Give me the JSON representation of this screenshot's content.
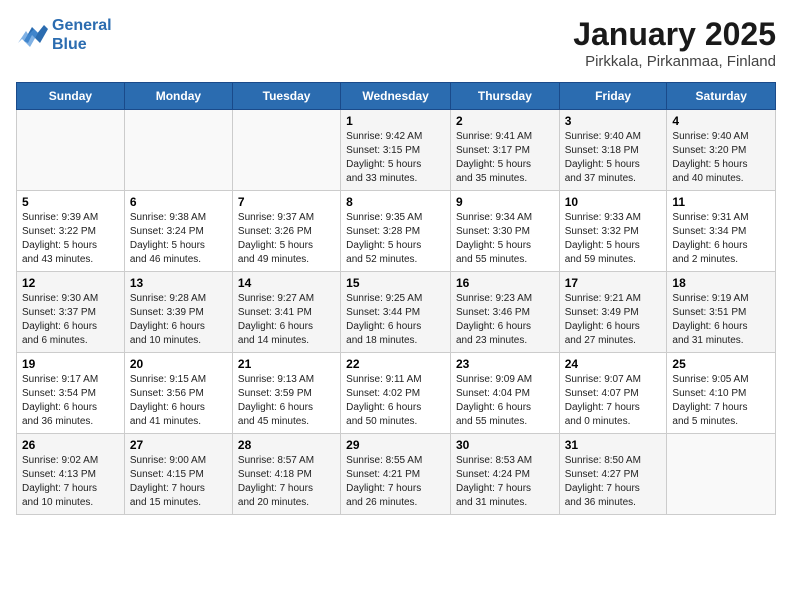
{
  "header": {
    "logo_line1": "General",
    "logo_line2": "Blue",
    "month": "January 2025",
    "location": "Pirkkala, Pirkanmaa, Finland"
  },
  "days_of_week": [
    "Sunday",
    "Monday",
    "Tuesday",
    "Wednesday",
    "Thursday",
    "Friday",
    "Saturday"
  ],
  "weeks": [
    [
      {
        "day": "",
        "info": ""
      },
      {
        "day": "",
        "info": ""
      },
      {
        "day": "",
        "info": ""
      },
      {
        "day": "1",
        "info": "Sunrise: 9:42 AM\nSunset: 3:15 PM\nDaylight: 5 hours\nand 33 minutes."
      },
      {
        "day": "2",
        "info": "Sunrise: 9:41 AM\nSunset: 3:17 PM\nDaylight: 5 hours\nand 35 minutes."
      },
      {
        "day": "3",
        "info": "Sunrise: 9:40 AM\nSunset: 3:18 PM\nDaylight: 5 hours\nand 37 minutes."
      },
      {
        "day": "4",
        "info": "Sunrise: 9:40 AM\nSunset: 3:20 PM\nDaylight: 5 hours\nand 40 minutes."
      }
    ],
    [
      {
        "day": "5",
        "info": "Sunrise: 9:39 AM\nSunset: 3:22 PM\nDaylight: 5 hours\nand 43 minutes."
      },
      {
        "day": "6",
        "info": "Sunrise: 9:38 AM\nSunset: 3:24 PM\nDaylight: 5 hours\nand 46 minutes."
      },
      {
        "day": "7",
        "info": "Sunrise: 9:37 AM\nSunset: 3:26 PM\nDaylight: 5 hours\nand 49 minutes."
      },
      {
        "day": "8",
        "info": "Sunrise: 9:35 AM\nSunset: 3:28 PM\nDaylight: 5 hours\nand 52 minutes."
      },
      {
        "day": "9",
        "info": "Sunrise: 9:34 AM\nSunset: 3:30 PM\nDaylight: 5 hours\nand 55 minutes."
      },
      {
        "day": "10",
        "info": "Sunrise: 9:33 AM\nSunset: 3:32 PM\nDaylight: 5 hours\nand 59 minutes."
      },
      {
        "day": "11",
        "info": "Sunrise: 9:31 AM\nSunset: 3:34 PM\nDaylight: 6 hours\nand 2 minutes."
      }
    ],
    [
      {
        "day": "12",
        "info": "Sunrise: 9:30 AM\nSunset: 3:37 PM\nDaylight: 6 hours\nand 6 minutes."
      },
      {
        "day": "13",
        "info": "Sunrise: 9:28 AM\nSunset: 3:39 PM\nDaylight: 6 hours\nand 10 minutes."
      },
      {
        "day": "14",
        "info": "Sunrise: 9:27 AM\nSunset: 3:41 PM\nDaylight: 6 hours\nand 14 minutes."
      },
      {
        "day": "15",
        "info": "Sunrise: 9:25 AM\nSunset: 3:44 PM\nDaylight: 6 hours\nand 18 minutes."
      },
      {
        "day": "16",
        "info": "Sunrise: 9:23 AM\nSunset: 3:46 PM\nDaylight: 6 hours\nand 23 minutes."
      },
      {
        "day": "17",
        "info": "Sunrise: 9:21 AM\nSunset: 3:49 PM\nDaylight: 6 hours\nand 27 minutes."
      },
      {
        "day": "18",
        "info": "Sunrise: 9:19 AM\nSunset: 3:51 PM\nDaylight: 6 hours\nand 31 minutes."
      }
    ],
    [
      {
        "day": "19",
        "info": "Sunrise: 9:17 AM\nSunset: 3:54 PM\nDaylight: 6 hours\nand 36 minutes."
      },
      {
        "day": "20",
        "info": "Sunrise: 9:15 AM\nSunset: 3:56 PM\nDaylight: 6 hours\nand 41 minutes."
      },
      {
        "day": "21",
        "info": "Sunrise: 9:13 AM\nSunset: 3:59 PM\nDaylight: 6 hours\nand 45 minutes."
      },
      {
        "day": "22",
        "info": "Sunrise: 9:11 AM\nSunset: 4:02 PM\nDaylight: 6 hours\nand 50 minutes."
      },
      {
        "day": "23",
        "info": "Sunrise: 9:09 AM\nSunset: 4:04 PM\nDaylight: 6 hours\nand 55 minutes."
      },
      {
        "day": "24",
        "info": "Sunrise: 9:07 AM\nSunset: 4:07 PM\nDaylight: 7 hours\nand 0 minutes."
      },
      {
        "day": "25",
        "info": "Sunrise: 9:05 AM\nSunset: 4:10 PM\nDaylight: 7 hours\nand 5 minutes."
      }
    ],
    [
      {
        "day": "26",
        "info": "Sunrise: 9:02 AM\nSunset: 4:13 PM\nDaylight: 7 hours\nand 10 minutes."
      },
      {
        "day": "27",
        "info": "Sunrise: 9:00 AM\nSunset: 4:15 PM\nDaylight: 7 hours\nand 15 minutes."
      },
      {
        "day": "28",
        "info": "Sunrise: 8:57 AM\nSunset: 4:18 PM\nDaylight: 7 hours\nand 20 minutes."
      },
      {
        "day": "29",
        "info": "Sunrise: 8:55 AM\nSunset: 4:21 PM\nDaylight: 7 hours\nand 26 minutes."
      },
      {
        "day": "30",
        "info": "Sunrise: 8:53 AM\nSunset: 4:24 PM\nDaylight: 7 hours\nand 31 minutes."
      },
      {
        "day": "31",
        "info": "Sunrise: 8:50 AM\nSunset: 4:27 PM\nDaylight: 7 hours\nand 36 minutes."
      },
      {
        "day": "",
        "info": ""
      }
    ]
  ]
}
